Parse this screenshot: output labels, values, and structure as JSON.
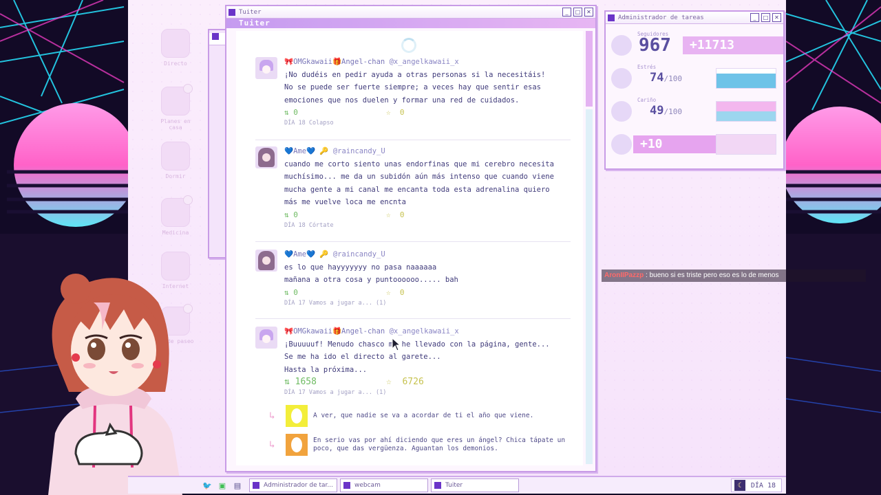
{
  "twitter_window": {
    "title": "Tuiter",
    "header": "Tuiter",
    "tweets": [
      {
        "author": "🎀OMGkawaii🎁Angel-chan",
        "handle": "@x_angelkawaii_x",
        "lines": [
          "¡No dudéis en pedir ayuda a otras personas si la necesitáis!",
          "No se puede ser fuerte siempre; a veces hay que sentir esas",
          "emociones que nos duelen y formar una red de cuidados."
        ],
        "retweets": "0",
        "favs": "0",
        "meta": "DÍA 18 Colapso"
      },
      {
        "author": "💙Ame💙 🔑",
        "handle": "@raincandy_U",
        "lines": [
          "cuando me corto siento unas endorfinas que mi cerebro necesita",
          "muchísimo... me da un subidón aún más intenso que cuando viene",
          "mucha gente a mi canal   me encanta toda esta adrenalina quiero",
          "más me vuelve loca me encnta"
        ],
        "retweets": "0",
        "favs": "0",
        "meta": "DÍA 18 Córtate"
      },
      {
        "author": "💙Ame💙 🔑",
        "handle": "@raincandy_U",
        "lines": [
          "es lo que hayyyyyyy no pasa naaaaaa",
          "mañana a otra cosa y puntoooooo..... bah"
        ],
        "retweets": "0",
        "favs": "0",
        "meta": "DÍA 17 Vamos a jugar a... (1)"
      },
      {
        "author": "🎀OMGkawaii🎁Angel-chan",
        "handle": "@x_angelkawaii_x",
        "lines": [
          "¡Buuuuuf! Menudo chasco me he llevado con la página, gente...",
          "Se me ha ido el directo al garete...",
          "Hasta la próxima..."
        ],
        "retweets": "1658",
        "favs": "6726",
        "meta": "DÍA 17 Vamos a jugar a... (1)"
      }
    ],
    "replies": [
      {
        "text": "A ver, que nadie se va a acordar de ti el año que viene.",
        "color": "#f3ee3a"
      },
      {
        "text": "En serio vas por ahí diciendo que eres un ángel? Chica tápate un poco, que das vergüenza. Aguantan los demonios.",
        "color": "#f1a33d"
      }
    ]
  },
  "task_manager": {
    "title": "Administrador de tareas",
    "stats": [
      {
        "label": "Seguidores",
        "value": "967",
        "delta": "+11713",
        "bar_color": "#e8b3f2"
      },
      {
        "label": "Estrés",
        "value": "74",
        "max": "/100",
        "fill": 0.74,
        "bar_color": "#6ec3e8"
      },
      {
        "label": "Cariño",
        "value": "49",
        "max": "/100",
        "fill": 0.49,
        "bar_color": "#f0a7e8"
      },
      {
        "label": "",
        "value": "+10",
        "bar_color": "#e6a4ef"
      }
    ]
  },
  "desktop_icons": [
    "Directo",
    "Planes en casa",
    "Dormir",
    "Medicina",
    "Internet",
    "Ir de paseo"
  ],
  "taskbar": {
    "items": [
      "Administrador de tar...",
      "webcam",
      "Tuiter"
    ],
    "day": "DÍA 18"
  },
  "chat": {
    "user": "AronIIPazzp",
    "message": "bueno si es triste pero eso es lo de menos"
  },
  "colors": {
    "accent_purple": "#6a34c8",
    "window_border": "#c89be6",
    "retweet_green": "#6fbb63",
    "fav_yellow": "#c6c24e"
  }
}
